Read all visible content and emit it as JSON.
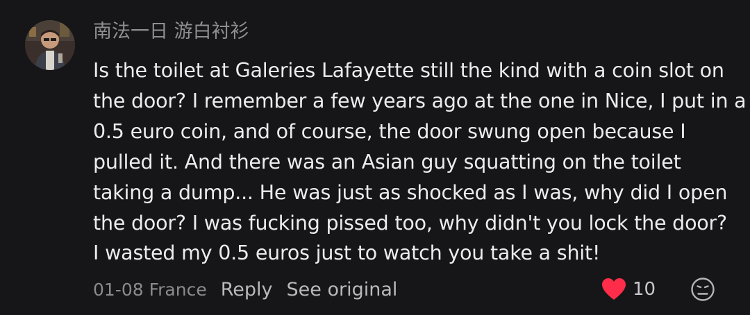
{
  "comment": {
    "username": "南法一日 游白衬衫",
    "lines": [
      "Is the toilet at Galeries Lafayette still the kind with a coin slot on",
      "the door? I remember a few years ago at the one in Nice, I put in a",
      "0.5 euro coin, and of course, the door swung open because I",
      "pulled it. And there was an Asian guy squatting on the toilet",
      "taking a dump... He was just as shocked as I was, why did I open",
      "the door? I was fucking pissed too, why didn't you lock the door?",
      "I wasted my 0.5 euros just to watch you take a shit!"
    ],
    "date_location": "01-08 France",
    "reply_label": "Reply",
    "see_original_label": "See original",
    "like_count": "10",
    "like_color": "#ff2d4a",
    "icons": {
      "avatar": "user-avatar",
      "like": "heart-icon",
      "dislike": "frown-face-icon"
    }
  }
}
